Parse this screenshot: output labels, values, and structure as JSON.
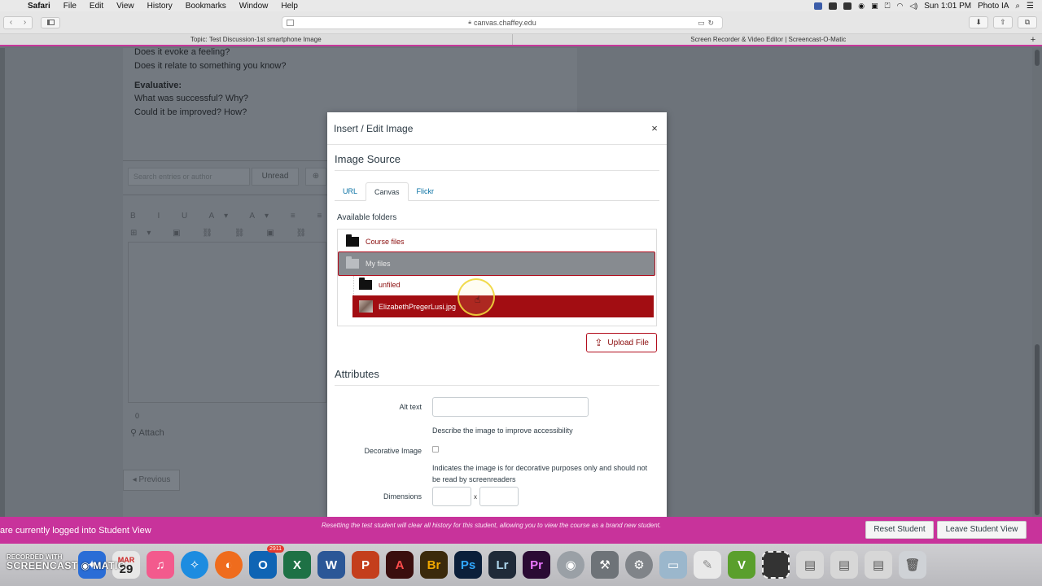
{
  "menubar": {
    "app": "Safari",
    "items": [
      "File",
      "Edit",
      "View",
      "History",
      "Bookmarks",
      "Window",
      "Help"
    ],
    "clock": "Sun 1:01 PM",
    "user": "Photo IA"
  },
  "browser": {
    "url": "canvas.chaffey.edu",
    "tabs": [
      {
        "title": "Topic: Test Discussion-1st smartphone Image"
      },
      {
        "title": "Screen Recorder & Video Editor | Screencast-O-Matic"
      }
    ]
  },
  "background": {
    "lines": [
      "Does it evoke a feeling?",
      "Does it relate to something you know?"
    ],
    "evaluative_heading": "Evaluative:",
    "evaluative_lines": [
      "What was successful? Why?",
      "Could it be improved? How?"
    ],
    "search_placeholder": "Search entries or author",
    "unread_label": "Unread",
    "word_count": "0",
    "attach_label": "Attach",
    "previous_label": "◂ Previous"
  },
  "modal": {
    "title": "Insert / Edit Image",
    "close": "×",
    "image_source_heading": "Image Source",
    "tabs": [
      {
        "label": "URL",
        "active": false
      },
      {
        "label": "Canvas",
        "active": true
      },
      {
        "label": "Flickr",
        "active": false
      }
    ],
    "available_folders": "Available folders",
    "tree": {
      "course_files": "Course files",
      "my_files": "My files",
      "unfiled": "unfiled",
      "selected_file": "ElizabethPregerLusi.jpg"
    },
    "upload_label": "Upload File",
    "attributes_heading": "Attributes",
    "alt_text_label": "Alt text",
    "alt_text_value": "",
    "alt_text_hint": "Describe the image to improve accessibility",
    "decorative_label": "Decorative Image",
    "decorative_checked": false,
    "decorative_hint": "Indicates the image is for decorative purposes only and should not be read by screenreaders",
    "dimensions_label": "Dimensions",
    "dimensions_sep": "x",
    "width_value": "",
    "height_value": ""
  },
  "student_view": {
    "message": "are currently logged into Student View",
    "reset_info": "Resetting the test student will clear all history for this student, allowing you to view the course as a brand new student.",
    "reset_button": "Reset Student",
    "leave_button": "Leave Student View"
  },
  "dock": {
    "watermark_top": "RECORDED WITH",
    "watermark_bottom": "SCREENCAST ◉ MATIC",
    "calendar_month": "MAR",
    "calendar_day": "29",
    "outlook_badge": "2911",
    "apps": [
      {
        "label": "O",
        "color": "#0f64b4",
        "icon": "outlook-icon"
      },
      {
        "label": "X",
        "color": "#1e7145",
        "icon": "excel-icon"
      },
      {
        "label": "W",
        "color": "#2b5797",
        "icon": "word-icon"
      },
      {
        "label": "P",
        "color": "#c43e1c",
        "icon": "powerpoint-icon"
      },
      {
        "label": "A",
        "color": "#3a0e0e",
        "icon": "acrobat-icon"
      },
      {
        "label": "Br",
        "color": "#3b2a0c",
        "icon": "bridge-icon"
      },
      {
        "label": "Ps",
        "color": "#0b1f3a",
        "icon": "photoshop-icon"
      },
      {
        "label": "Lr",
        "color": "#1f2a38",
        "icon": "lightroom-icon"
      },
      {
        "label": "Pr",
        "color": "#2a0b33",
        "icon": "premiere-icon"
      }
    ]
  }
}
